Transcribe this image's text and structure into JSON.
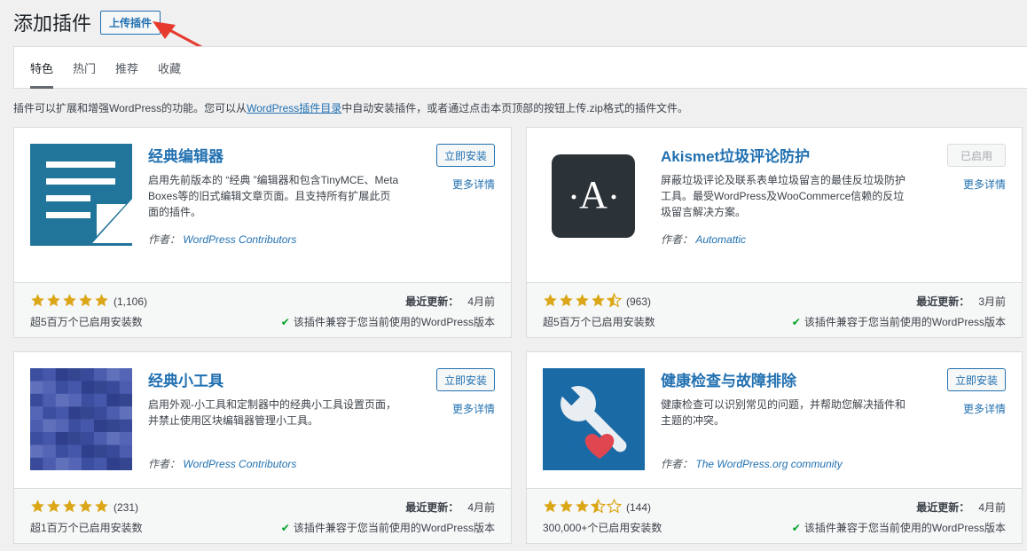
{
  "header": {
    "title": "添加插件",
    "upload_label": "上传插件"
  },
  "tabs": [
    {
      "label": "特色",
      "current": true
    },
    {
      "label": "热门",
      "current": false
    },
    {
      "label": "推荐",
      "current": false
    },
    {
      "label": "收藏",
      "current": false
    }
  ],
  "intro": {
    "before": "插件可以扩展和增强WordPress的功能。您可以从",
    "link": "WordPress插件目录",
    "after": "中自动安装插件，或者通过点击本页顶部的按钮上传.zip格式的插件文件。"
  },
  "labels": {
    "more_details": "更多详情",
    "author_prefix": "作者：",
    "last_updated": "最近更新：",
    "compat_text": "该插件兼容于您当前使用的WordPress版本",
    "compat_icon": "check-icon"
  },
  "colors": {
    "accent": "#2271b1",
    "star": "#dba617",
    "check": "#00a32a"
  },
  "plugins": [
    {
      "name": "经典编辑器",
      "desc": "启用先前版本的 “经典 ”编辑器和包含TinyMCE、Meta Boxes等的旧式编辑文章页面。且支持所有扩展此页面的插件。",
      "author": "WordPress Contributors",
      "action": "立即安装",
      "rating_count": "(1,106)",
      "stars": 5,
      "installs": "超5百万个已启用安装数",
      "updated": "4月前",
      "icon": "classic-editor-icon"
    },
    {
      "name": "Akismet垃圾评论防护",
      "desc": "屏蔽垃圾评论及联系表单垃圾留言的最佳反垃圾防护工具。最受WordPress及WooCommerce信赖的反垃圾留言解决方案。",
      "author": "Automattic",
      "action": "已启用",
      "rating_count": "(963)",
      "stars": 4.5,
      "installs": "超5百万个已启用安装数",
      "updated": "3月前",
      "icon": "akismet-icon"
    },
    {
      "name": "经典小工具",
      "desc": "启用外观-小工具和定制器中的经典小工具设置页面，并禁止使用区块编辑器管理小工具。",
      "author": "WordPress Contributors",
      "action": "立即安装",
      "rating_count": "(231)",
      "stars": 5,
      "installs": "超1百万个已启用安装数",
      "updated": "4月前",
      "icon": "classic-widgets-icon"
    },
    {
      "name": "健康检查与故障排除",
      "desc": "健康检查可以识别常见的问题，并帮助您解决插件和主题的冲突。",
      "author": "The WordPress.org community",
      "action": "立即安装",
      "rating_count": "(144)",
      "stars": 3.5,
      "installs": "300,000+个已启用安装数",
      "updated": "4月前",
      "icon": "health-check-icon"
    }
  ]
}
